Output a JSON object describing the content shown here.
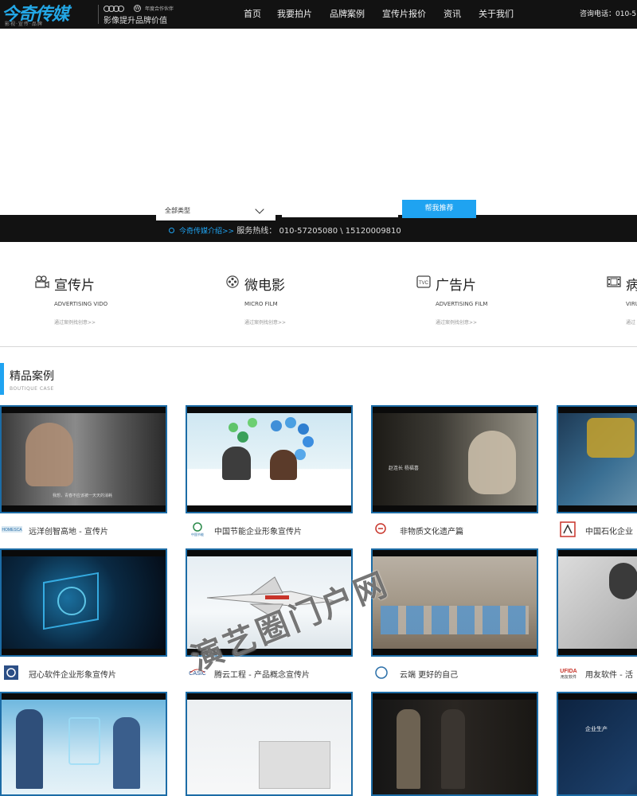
{
  "header": {
    "logo_text": "今奇传媒",
    "logo_sub": "影视·宣传·品牌",
    "partner_line": "年度合作伙伴",
    "slogan": "影像提升品牌价值",
    "nav": [
      "首页",
      "我要拍片",
      "品牌案例",
      "宣传片报价",
      "资讯",
      "关于我们"
    ],
    "hotline": "咨询电话：010-5"
  },
  "search": {
    "select_value": "全部类型",
    "button_label": "帮我推荐",
    "intro_link": "今奇传媒介绍>>",
    "hotline_text": "服务热线：  010-57205080 \\ 15120009810"
  },
  "categories": [
    {
      "title": "宣传片",
      "en": "ADVERTISING VIDO",
      "link": "通过案例找创意>>",
      "icon": "camera-icon"
    },
    {
      "title": "微电影",
      "en": "MICRO FILM",
      "link": "通过案例找创意>>",
      "icon": "film-reel-icon"
    },
    {
      "title": "广告片",
      "en": "ADVERTISING FILM",
      "link": "通过案例找创意>>",
      "icon": "tvc-icon"
    },
    {
      "title": "病",
      "en": "VIRU",
      "link": "通过",
      "icon": "film-strip-icon"
    }
  ],
  "boutique": {
    "title": "精品案例",
    "subtitle": "BOUTIQUE CASE",
    "cases": [
      {
        "title": "远洋创智高地 - 宣传片",
        "caption": "我想，青春不应该被一天天的消耗"
      },
      {
        "title": "中国节能企业形象宣传片",
        "caption": ""
      },
      {
        "title": "非物质文化遗产篇",
        "caption": "赵连长 杨福喜"
      },
      {
        "title": "中国石化企业",
        "caption": ""
      },
      {
        "title": "冠心软件企业形象宣传片",
        "caption": ""
      },
      {
        "title": "腾云工程 - 产品概念宣传片",
        "caption": ""
      },
      {
        "title": "云端 更好的自己",
        "caption": ""
      },
      {
        "title": "用友软件 - 活",
        "caption": ""
      },
      {
        "title": "",
        "caption": ""
      },
      {
        "title": "",
        "caption": ""
      },
      {
        "title": "",
        "caption": "企业生产"
      },
      {
        "title": "",
        "caption": ""
      }
    ]
  },
  "watermark": "演艺圈门户网",
  "colors": {
    "accent": "#1fa3f1",
    "dark": "#121212",
    "thumb_border": "#1c6ca6"
  }
}
